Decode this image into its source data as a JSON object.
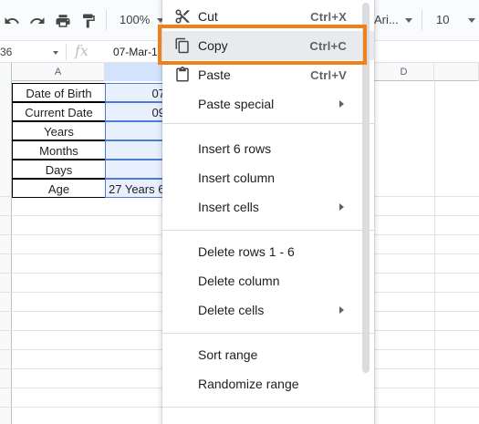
{
  "toolbar": {
    "zoom": "100%",
    "font": "Ari...",
    "font_size": "10",
    "undo_icon": "undo-icon",
    "redo_icon": "redo-icon",
    "print_icon": "print-icon",
    "paint_format_icon": "paint-format-icon"
  },
  "formula_bar": {
    "name_box": "36",
    "fx": "fx",
    "value": "07-Mar-1"
  },
  "grid": {
    "columns": [
      "A",
      "D"
    ],
    "rows": [
      {
        "label": "Date of Birth",
        "value": "07"
      },
      {
        "label": "Current Date",
        "value": "09"
      },
      {
        "label": "Years",
        "value": ""
      },
      {
        "label": "Months",
        "value": ""
      },
      {
        "label": "Days",
        "value": ""
      },
      {
        "label": "Age",
        "value": "27 Years 6"
      }
    ]
  },
  "menu": {
    "items": [
      {
        "label": "Cut",
        "shortcut": "Ctrl+X",
        "icon": "scissors-icon"
      },
      {
        "label": "Copy",
        "shortcut": "Ctrl+C",
        "icon": "copy-icon"
      },
      {
        "label": "Paste",
        "shortcut": "Ctrl+V",
        "icon": "clipboard-icon"
      },
      {
        "label": "Paste special"
      },
      {
        "label": "Insert 6 rows"
      },
      {
        "label": "Insert column"
      },
      {
        "label": "Insert cells"
      },
      {
        "label": "Delete rows 1 - 6"
      },
      {
        "label": "Delete column"
      },
      {
        "label": "Delete cells"
      },
      {
        "label": "Sort range"
      },
      {
        "label": "Randomize range"
      }
    ]
  },
  "colors": {
    "highlight_border": "#f0801a",
    "selection_fill": "#e8f0fe",
    "selection_border": "#4e7bdb",
    "hover": "#e8eaed"
  }
}
